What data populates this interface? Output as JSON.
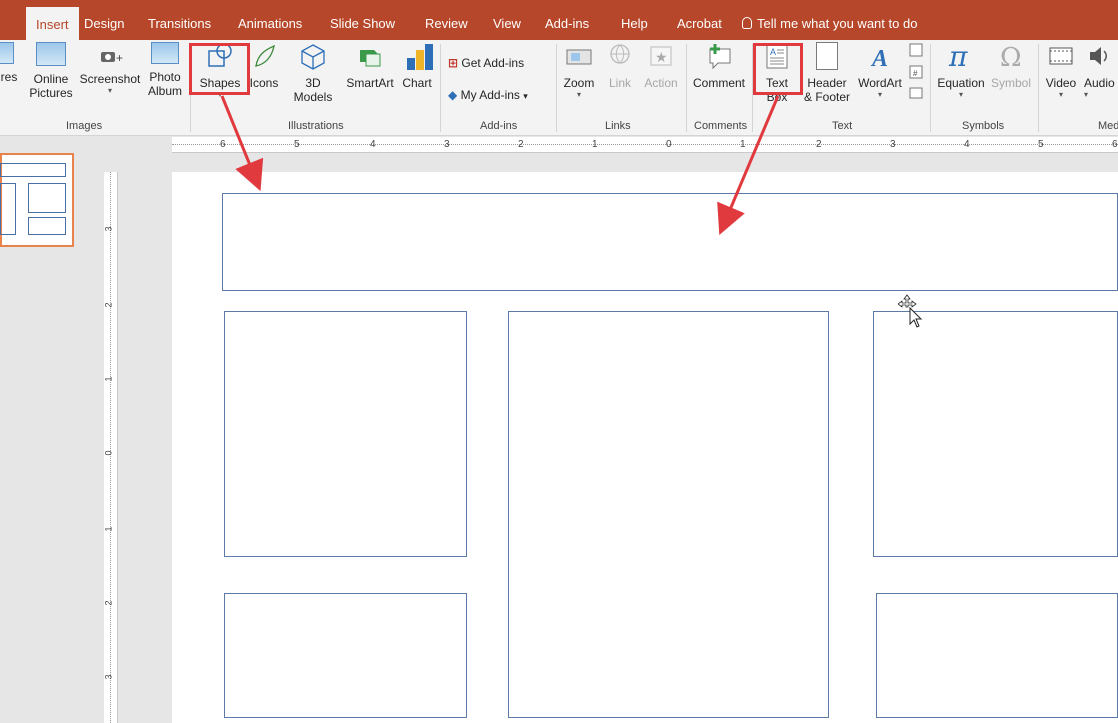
{
  "tabs": [
    {
      "label": "Insert",
      "active": true
    },
    {
      "label": "Design"
    },
    {
      "label": "Transitions"
    },
    {
      "label": "Animations"
    },
    {
      "label": "Slide Show"
    },
    {
      "label": "Review"
    },
    {
      "label": "View"
    },
    {
      "label": "Add-ins"
    },
    {
      "label": "Help"
    },
    {
      "label": "Acrobat"
    }
  ],
  "tell_me": "Tell me what you want to do",
  "ribbon": {
    "images": {
      "pictures_partial": "res",
      "online_pictures_1": "Online",
      "online_pictures_2": "Pictures",
      "screenshot": "Screenshot",
      "photo_album_1": "Photo",
      "photo_album_2": "Album",
      "group": "Images"
    },
    "illustrations": {
      "shapes": "Shapes",
      "icons": "Icons",
      "models_1": "3D",
      "models_2": "Models",
      "smartart": "SmartArt",
      "chart": "Chart",
      "group": "Illustrations"
    },
    "addins": {
      "get": "Get Add-ins",
      "my": "My Add-ins",
      "group": "Add-ins"
    },
    "links": {
      "zoom": "Zoom",
      "link": "Link",
      "action": "Action",
      "group": "Links"
    },
    "comments": {
      "comment": "Comment",
      "group": "Comments"
    },
    "text": {
      "textbox_1": "Text",
      "textbox_2": "Box",
      "header_1": "Header",
      "header_2": "& Footer",
      "wordart": "WordArt",
      "group": "Text"
    },
    "symbols": {
      "equation": "Equation",
      "symbol": "Symbol",
      "group": "Symbols"
    },
    "media": {
      "video": "Video",
      "audio_partial": "Audio",
      "group_partial": "Med"
    }
  },
  "ruler_h": [
    "6",
    "5",
    "4",
    "3",
    "2",
    "1",
    "0",
    "1",
    "2",
    "3",
    "4",
    "5",
    "6"
  ],
  "ruler_v": [
    "3",
    "2",
    "1",
    "0",
    "1",
    "2",
    "3"
  ],
  "colors": {
    "accent": "#b7472a",
    "highlight": "#e0393e",
    "box_border": "#5b7aa8",
    "thumb_border": "#e9834e"
  }
}
